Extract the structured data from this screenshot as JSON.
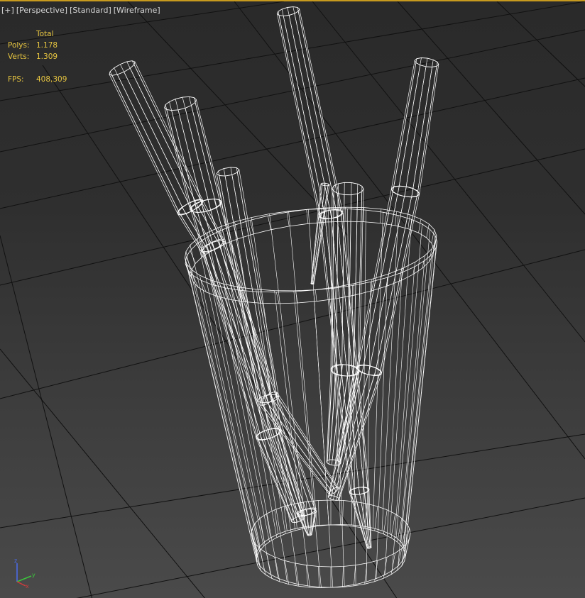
{
  "viewport": {
    "labels": [
      "[+]",
      "[Perspective]",
      "[Standard]",
      "[Wireframe]"
    ],
    "active_border_color": "#c79a1e",
    "wire_color": "#ffffff",
    "grid_color": "#111111"
  },
  "stats": {
    "header": "Total",
    "polys_label": "Polys:",
    "polys_value": "1.178",
    "verts_label": "Verts:",
    "verts_value": "1.309",
    "fps_label": "FPS:",
    "fps_value": "408,309",
    "color": "#e8c640"
  },
  "gizmo": {
    "axes": [
      "x",
      "y",
      "z"
    ],
    "colors": {
      "x": "#d23c3c",
      "y": "#3cc43c",
      "z": "#4a6cf0"
    }
  },
  "scene": {
    "objects": [
      "glass",
      "pencil",
      "pencil",
      "pencil",
      "pencil",
      "pen",
      "pen",
      "pen"
    ]
  }
}
